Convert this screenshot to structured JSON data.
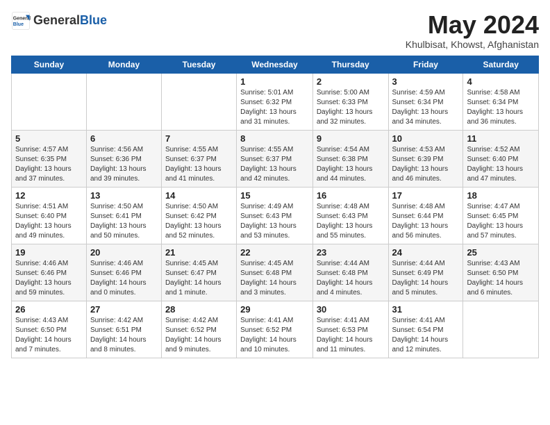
{
  "header": {
    "logo_general": "General",
    "logo_blue": "Blue",
    "month_title": "May 2024",
    "location": "Khulbisat, Khowst, Afghanistan"
  },
  "days_of_week": [
    "Sunday",
    "Monday",
    "Tuesday",
    "Wednesday",
    "Thursday",
    "Friday",
    "Saturday"
  ],
  "weeks": [
    [
      {
        "date": "",
        "info": ""
      },
      {
        "date": "",
        "info": ""
      },
      {
        "date": "",
        "info": ""
      },
      {
        "date": "1",
        "info": "Sunrise: 5:01 AM\nSunset: 6:32 PM\nDaylight: 13 hours and 31 minutes."
      },
      {
        "date": "2",
        "info": "Sunrise: 5:00 AM\nSunset: 6:33 PM\nDaylight: 13 hours and 32 minutes."
      },
      {
        "date": "3",
        "info": "Sunrise: 4:59 AM\nSunset: 6:34 PM\nDaylight: 13 hours and 34 minutes."
      },
      {
        "date": "4",
        "info": "Sunrise: 4:58 AM\nSunset: 6:34 PM\nDaylight: 13 hours and 36 minutes."
      }
    ],
    [
      {
        "date": "5",
        "info": "Sunrise: 4:57 AM\nSunset: 6:35 PM\nDaylight: 13 hours and 37 minutes."
      },
      {
        "date": "6",
        "info": "Sunrise: 4:56 AM\nSunset: 6:36 PM\nDaylight: 13 hours and 39 minutes."
      },
      {
        "date": "7",
        "info": "Sunrise: 4:55 AM\nSunset: 6:37 PM\nDaylight: 13 hours and 41 minutes."
      },
      {
        "date": "8",
        "info": "Sunrise: 4:55 AM\nSunset: 6:37 PM\nDaylight: 13 hours and 42 minutes."
      },
      {
        "date": "9",
        "info": "Sunrise: 4:54 AM\nSunset: 6:38 PM\nDaylight: 13 hours and 44 minutes."
      },
      {
        "date": "10",
        "info": "Sunrise: 4:53 AM\nSunset: 6:39 PM\nDaylight: 13 hours and 46 minutes."
      },
      {
        "date": "11",
        "info": "Sunrise: 4:52 AM\nSunset: 6:40 PM\nDaylight: 13 hours and 47 minutes."
      }
    ],
    [
      {
        "date": "12",
        "info": "Sunrise: 4:51 AM\nSunset: 6:40 PM\nDaylight: 13 hours and 49 minutes."
      },
      {
        "date": "13",
        "info": "Sunrise: 4:50 AM\nSunset: 6:41 PM\nDaylight: 13 hours and 50 minutes."
      },
      {
        "date": "14",
        "info": "Sunrise: 4:50 AM\nSunset: 6:42 PM\nDaylight: 13 hours and 52 minutes."
      },
      {
        "date": "15",
        "info": "Sunrise: 4:49 AM\nSunset: 6:43 PM\nDaylight: 13 hours and 53 minutes."
      },
      {
        "date": "16",
        "info": "Sunrise: 4:48 AM\nSunset: 6:43 PM\nDaylight: 13 hours and 55 minutes."
      },
      {
        "date": "17",
        "info": "Sunrise: 4:48 AM\nSunset: 6:44 PM\nDaylight: 13 hours and 56 minutes."
      },
      {
        "date": "18",
        "info": "Sunrise: 4:47 AM\nSunset: 6:45 PM\nDaylight: 13 hours and 57 minutes."
      }
    ],
    [
      {
        "date": "19",
        "info": "Sunrise: 4:46 AM\nSunset: 6:46 PM\nDaylight: 13 hours and 59 minutes."
      },
      {
        "date": "20",
        "info": "Sunrise: 4:46 AM\nSunset: 6:46 PM\nDaylight: 14 hours and 0 minutes."
      },
      {
        "date": "21",
        "info": "Sunrise: 4:45 AM\nSunset: 6:47 PM\nDaylight: 14 hours and 1 minute."
      },
      {
        "date": "22",
        "info": "Sunrise: 4:45 AM\nSunset: 6:48 PM\nDaylight: 14 hours and 3 minutes."
      },
      {
        "date": "23",
        "info": "Sunrise: 4:44 AM\nSunset: 6:48 PM\nDaylight: 14 hours and 4 minutes."
      },
      {
        "date": "24",
        "info": "Sunrise: 4:44 AM\nSunset: 6:49 PM\nDaylight: 14 hours and 5 minutes."
      },
      {
        "date": "25",
        "info": "Sunrise: 4:43 AM\nSunset: 6:50 PM\nDaylight: 14 hours and 6 minutes."
      }
    ],
    [
      {
        "date": "26",
        "info": "Sunrise: 4:43 AM\nSunset: 6:50 PM\nDaylight: 14 hours and 7 minutes."
      },
      {
        "date": "27",
        "info": "Sunrise: 4:42 AM\nSunset: 6:51 PM\nDaylight: 14 hours and 8 minutes."
      },
      {
        "date": "28",
        "info": "Sunrise: 4:42 AM\nSunset: 6:52 PM\nDaylight: 14 hours and 9 minutes."
      },
      {
        "date": "29",
        "info": "Sunrise: 4:41 AM\nSunset: 6:52 PM\nDaylight: 14 hours and 10 minutes."
      },
      {
        "date": "30",
        "info": "Sunrise: 4:41 AM\nSunset: 6:53 PM\nDaylight: 14 hours and 11 minutes."
      },
      {
        "date": "31",
        "info": "Sunrise: 4:41 AM\nSunset: 6:54 PM\nDaylight: 14 hours and 12 minutes."
      },
      {
        "date": "",
        "info": ""
      }
    ]
  ]
}
